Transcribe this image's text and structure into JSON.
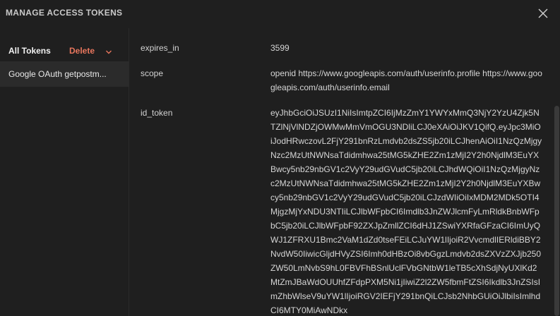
{
  "modal": {
    "title": "MANAGE ACCESS TOKENS",
    "close_icon": "close-icon"
  },
  "sidebar": {
    "all_tokens_label": "All Tokens",
    "delete_label": "Delete",
    "delete_icon": "chevron-down-icon",
    "tokens": [
      {
        "label": "Google OAuth getpostm..."
      }
    ]
  },
  "details": [
    {
      "key": "expires_in",
      "value": "3599"
    },
    {
      "key": "scope",
      "value": "openid https://www.googleapis.com/auth/userinfo.profile https://www.googleapis.com/auth/userinfo.email"
    },
    {
      "key": "id_token",
      "value": "eyJhbGciOiJSUzI1NiIsImtpZCI6IjMzZmY1YWYxMmQ3NjY2YzU4Zjk5NTZlNjVlNDZjOWMwMmVmOGU3NDliLCJ0eXAiOiJKV1QifQ.eyJpc3MiOiJodHRwczovL2FjY291bnRzLmdvb2dsZS5jb20iLCJhenAiOiI1NzQzMjgyNzc2MzUtNWNsaTdidmhwa25tMG5kZHE2Zm1zMjI2Y2h0NjdlM3EuYXBwcy5nb29nbGV1c2VyY29udGVudC5jb20iLCJhdWQiOiI1NzQzMjgyNzc2MzUtNWNsaTdidmhwa25tMG5kZHE2Zm1zMjI2Y2h0NjdlM3EuYXBwcy5nb29nbGV1c2VyY29udGVudC5jb20iLCJzdWIiOiIxMDM2MDk5OTI4MjgzMjYxNDU3NTIiLCJlbWFpbCI6Imdlb3JnZWJlcmFyLmRldkBnbWFpbC5jb20iLCJlbWFpbF92ZXJpZmllZCI6dHJ1ZSwiYXRfaGFzaCI6ImUyQWJ1ZFRXU1Bmc2VaM1dZd0tseFEiLCJuYW1lIjoiR2VvcmdlIERldiBBY2NvdW50IiwicGljdHVyZSI6Imh0dHBzOi8vbGgzLmdvb2dsZXVzZXJjb250ZW50LmNvbS9hL0FBVFhBSnlUclFVbGNtbW1leTB5cXhSdjNyUXlKd2MtZmJBaWdOUUhfZFdpPXM5Ni1jIiwiZ2l2ZW5fbmFtZSI6Ikdlb3JnZSIsImZhbWlseV9uYW1lIjoiRGV2IEFjY291bnQiLCJsb2NhbGUiOiJlbiIsImlhdCI6MTY0MiAwNDkx"
    }
  ]
}
